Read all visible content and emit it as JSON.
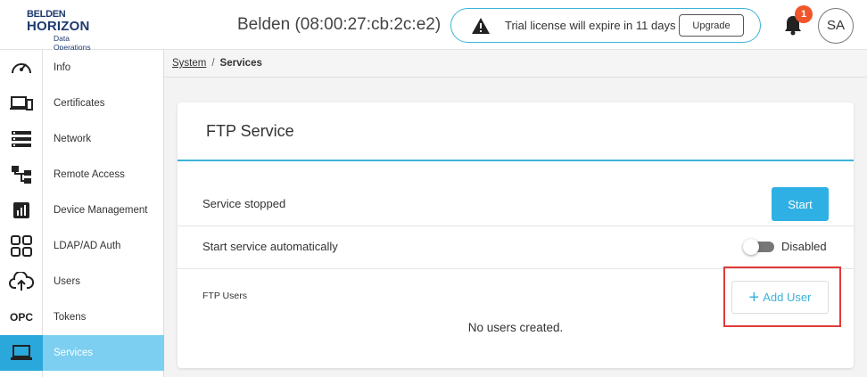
{
  "header": {
    "logo": {
      "line1": "BELDEN",
      "line2": "HORIZON",
      "line3": "Data Operations"
    },
    "device_title": "Belden (08:00:27:cb:2c:e2)",
    "license_message": "Trial license will expire in 11 days",
    "upgrade_label": "Upgrade",
    "notification_count": "1",
    "avatar_initials": "SA"
  },
  "sidebar": {
    "items": [
      {
        "label": "Info",
        "icon": "speedometer-icon"
      },
      {
        "label": "Certificates",
        "icon": "devices-icon"
      },
      {
        "label": "Network",
        "icon": "network-list-icon"
      },
      {
        "label": "Remote Access",
        "icon": "hierarchy-icon"
      },
      {
        "label": "Device Management",
        "icon": "chart-box-icon"
      },
      {
        "label": "LDAP/AD Auth",
        "icon": "grid-icon"
      },
      {
        "label": "Users",
        "icon": "cloud-upload-icon"
      },
      {
        "label": "Tokens",
        "icon": "opc-icon",
        "icon_text": "OPC"
      },
      {
        "label": "Services",
        "icon": "laptop-icon",
        "active": true
      }
    ]
  },
  "breadcrumb": {
    "parent": "System",
    "separator": "/",
    "current": "Services"
  },
  "card": {
    "title": "FTP Service",
    "status_text": "Service stopped",
    "start_label": "Start",
    "auto_start_label": "Start service automatically",
    "toggle_state": "Disabled",
    "ftp_users_label": "FTP Users",
    "add_user_label": "Add User",
    "empty_message": "No users created."
  },
  "colors": {
    "accent": "#2fb0e4",
    "active_nav": "#7ccff0",
    "highlight": "#e03a3a",
    "badge": "#f0562b"
  }
}
